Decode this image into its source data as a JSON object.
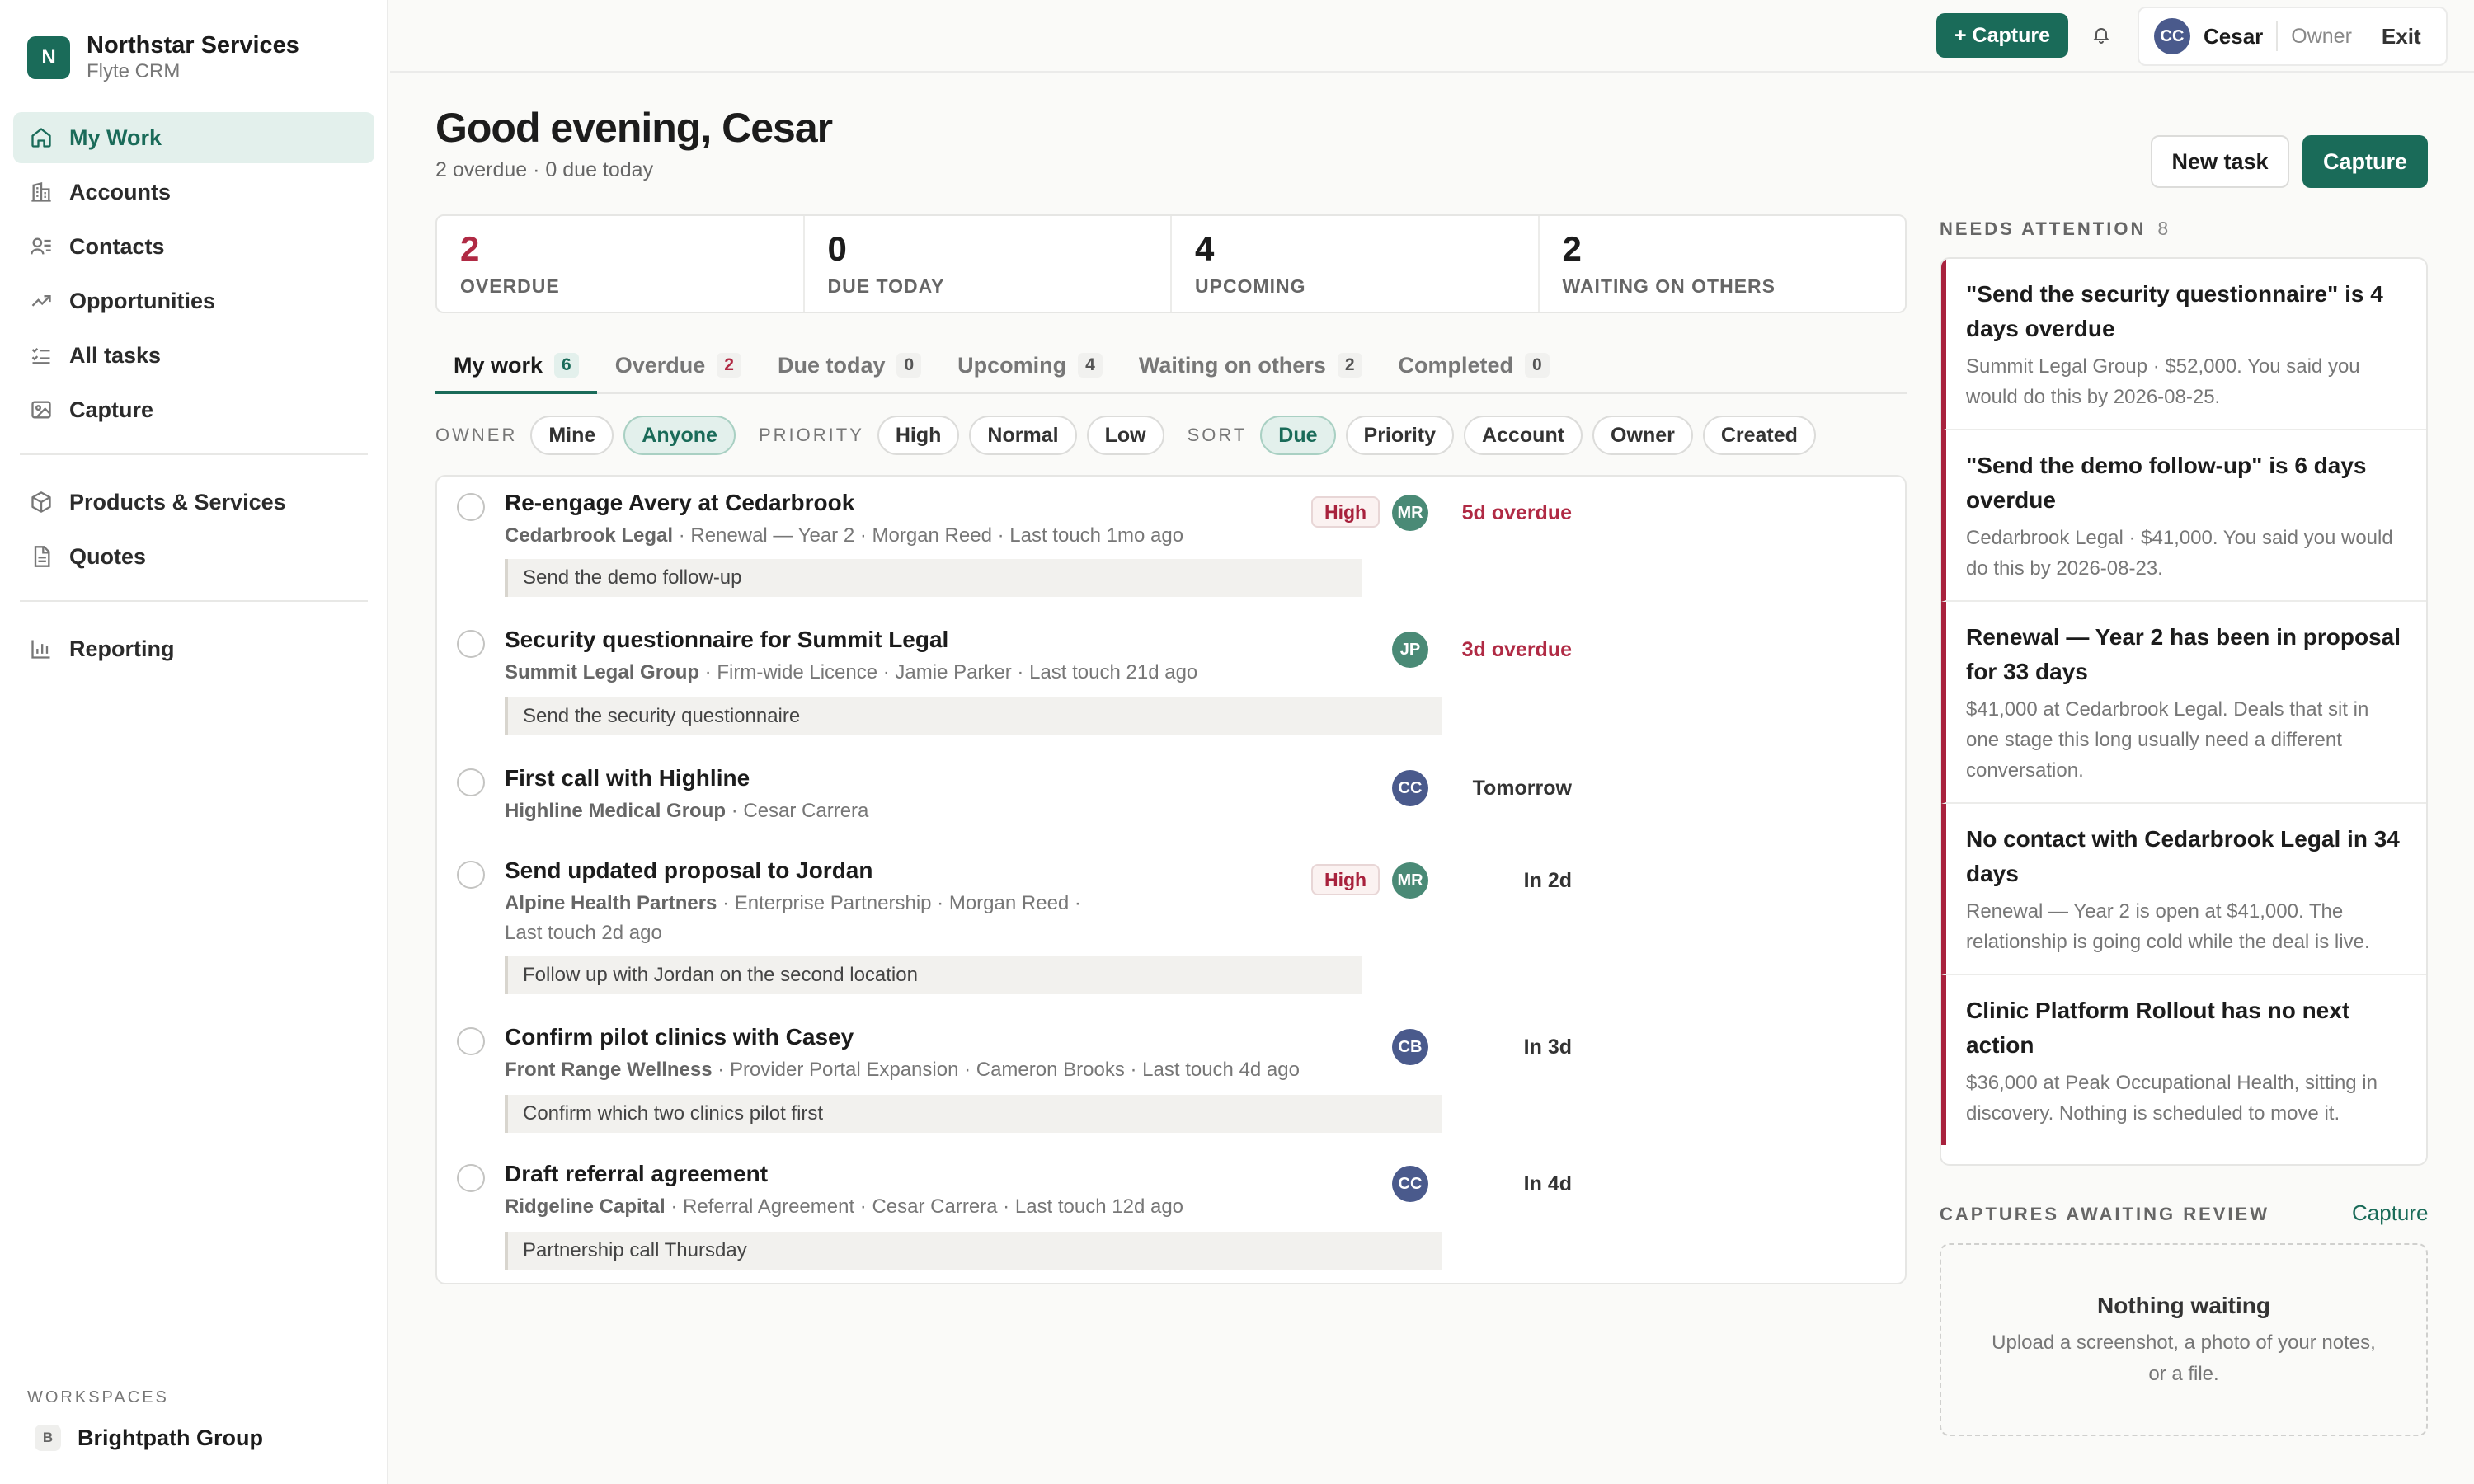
{
  "app": {
    "name": "Northstar Services",
    "subtitle": "Flyte CRM",
    "logo_letter": "N"
  },
  "sidebar": {
    "items": [
      {
        "label": "My Work",
        "icon": "home-icon",
        "active": true
      },
      {
        "label": "Accounts",
        "icon": "building-icon"
      },
      {
        "label": "Contacts",
        "icon": "users-icon"
      },
      {
        "label": "Opportunities",
        "icon": "trending-up-icon"
      },
      {
        "label": "All tasks",
        "icon": "checklist-icon"
      },
      {
        "label": "Capture",
        "icon": "image-icon"
      },
      {
        "label": "Products & Services",
        "icon": "box-icon"
      },
      {
        "label": "Quotes",
        "icon": "document-icon"
      },
      {
        "label": "Reporting",
        "icon": "bar-chart-icon"
      }
    ],
    "workspaces_label": "WORKSPACES",
    "workspace": {
      "letter": "B",
      "name": "Brightpath Group"
    }
  },
  "topbar": {
    "capture_label": "+ Capture",
    "user": {
      "initials": "CC",
      "name": "Cesar",
      "role": "Owner",
      "exit": "Exit"
    }
  },
  "header": {
    "greeting": "Good evening, Cesar",
    "subtitle": "2 overdue · 0 due today",
    "new_task": "New task",
    "capture": "Capture"
  },
  "stats": [
    {
      "value": "2",
      "label": "OVERDUE",
      "alert": true
    },
    {
      "value": "0",
      "label": "DUE TODAY"
    },
    {
      "value": "4",
      "label": "UPCOMING"
    },
    {
      "value": "2",
      "label": "WAITING ON OTHERS"
    }
  ],
  "tabs": [
    {
      "label": "My work",
      "count": "6",
      "active": true
    },
    {
      "label": "Overdue",
      "count": "2",
      "alert": true
    },
    {
      "label": "Due today",
      "count": "0"
    },
    {
      "label": "Upcoming",
      "count": "4"
    },
    {
      "label": "Waiting on others",
      "count": "2"
    },
    {
      "label": "Completed",
      "count": "0"
    }
  ],
  "filters": {
    "owner_label": "OWNER",
    "owner": [
      "Mine",
      "Anyone"
    ],
    "owner_selected": "Anyone",
    "priority_label": "PRIORITY",
    "priority": [
      "High",
      "Normal",
      "Low"
    ],
    "sort_label": "SORT",
    "sort": [
      "Due",
      "Priority",
      "Account",
      "Owner",
      "Created"
    ],
    "sort_selected": "Due"
  },
  "tasks": [
    {
      "title": "Re-engage Avery at Cedarbrook",
      "account": "Cedarbrook Legal",
      "meta": [
        "Renewal — Year 2",
        "Morgan Reed",
        "Last touch 1mo ago"
      ],
      "note": "Send the demo follow-up",
      "priority": "High",
      "owner_initials": "MR",
      "due": "5d overdue",
      "overdue": true
    },
    {
      "title": "Security questionnaire for Summit Legal",
      "account": "Summit Legal Group",
      "meta": [
        "Firm-wide Licence",
        "Jamie Parker",
        "Last touch 21d ago"
      ],
      "note": "Send the security questionnaire",
      "owner_initials": "JP",
      "due": "3d overdue",
      "overdue": true
    },
    {
      "title": "First call with Highline",
      "account": "Highline Medical Group",
      "meta": [
        "Cesar Carrera"
      ],
      "owner_initials": "CC",
      "due": "Tomorrow"
    },
    {
      "title": "Send updated proposal to Jordan",
      "account": "Alpine Health Partners",
      "meta": [
        "Enterprise Partnership",
        "Morgan Reed"
      ],
      "meta2": "Last touch 2d ago",
      "note": "Follow up with Jordan on the second location",
      "priority": "High",
      "owner_initials": "MR",
      "due": "In 2d"
    },
    {
      "title": "Confirm pilot clinics with Casey",
      "account": "Front Range Wellness",
      "meta": [
        "Provider Portal Expansion",
        "Cameron Brooks",
        "Last touch 4d ago"
      ],
      "note": "Confirm which two clinics pilot first",
      "owner_initials": "CB",
      "due": "In 3d"
    },
    {
      "title": "Draft referral agreement",
      "account": "Ridgeline Capital",
      "meta": [
        "Referral Agreement",
        "Cesar Carrera",
        "Last touch 12d ago"
      ],
      "note": "Partnership call Thursday",
      "owner_initials": "CC",
      "due": "In 4d"
    }
  ],
  "needs_attention": {
    "label": "NEEDS ATTENTION",
    "count": "8",
    "items": [
      {
        "title": "\"Send the security questionnaire\" is 4 days overdue",
        "body": "Summit Legal Group · $52,000. You said you would do this by 2026-08-25."
      },
      {
        "title": "\"Send the demo follow-up\" is 6 days overdue",
        "body": "Cedarbrook Legal · $41,000. You said you would do this by 2026-08-23."
      },
      {
        "title": "Renewal — Year 2 has been in proposal for 33 days",
        "body": "$41,000 at Cedarbrook Legal. Deals that sit in one stage this long usually need a different conversation."
      },
      {
        "title": "No contact with Cedarbrook Legal in 34 days",
        "body": "Renewal — Year 2 is open at $41,000. The relationship is going cold while the deal is live."
      },
      {
        "title": "Clinic Platform Rollout has no next action",
        "body": "$36,000 at Peak Occupational Health, sitting in discovery. Nothing is scheduled to move it."
      }
    ]
  },
  "captures": {
    "label": "CAPTURES AWAITING REVIEW",
    "link": "Capture",
    "empty_title": "Nothing waiting",
    "empty_body": "Upload a screenshot, a photo of your notes, or a file."
  },
  "colors": {
    "accent": "#1a6b59",
    "alert": "#b02a44",
    "accent_light": "#e3f0ec"
  }
}
